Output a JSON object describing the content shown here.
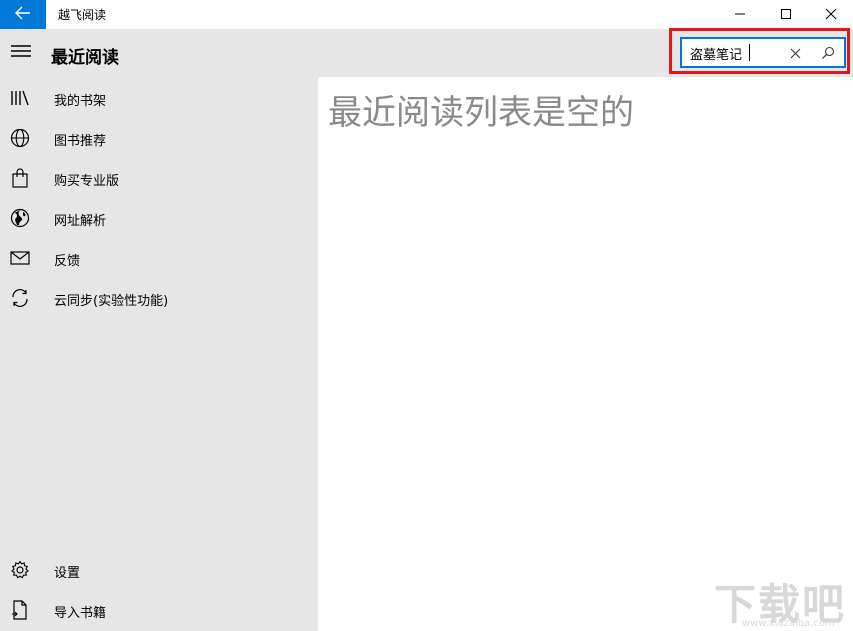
{
  "window": {
    "title": "越飞阅读",
    "back_icon": "arrow-left-icon",
    "minimize_icon": "minimize-icon",
    "maximize_icon": "maximize-icon",
    "close_icon": "close-icon",
    "accent_color": "#0078d7"
  },
  "header": {
    "title": "最近阅读",
    "menu_icon": "hamburger-icon"
  },
  "search": {
    "value": "盗墓笔记",
    "clear_icon": "clear-icon",
    "search_icon": "search-icon",
    "highlight_color": "#e0171b"
  },
  "sidebar": {
    "items": [
      {
        "label": "我的书架",
        "icon": "bookshelf-icon"
      },
      {
        "label": "图书推荐",
        "icon": "globe-icon"
      },
      {
        "label": "购买专业版",
        "icon": "shopping-bag-icon"
      },
      {
        "label": "网址解析",
        "icon": "world-icon"
      },
      {
        "label": "反馈",
        "icon": "mail-icon"
      },
      {
        "label": "云同步(实验性功能)",
        "icon": "sync-icon"
      }
    ],
    "bottom_items": [
      {
        "label": "设置",
        "icon": "gear-icon"
      },
      {
        "label": "导入书籍",
        "icon": "import-file-icon"
      }
    ]
  },
  "main": {
    "empty_message": "最近阅读列表是空的"
  },
  "watermark": {
    "text": "下载吧",
    "sub": "www.xiazaiba.com"
  }
}
